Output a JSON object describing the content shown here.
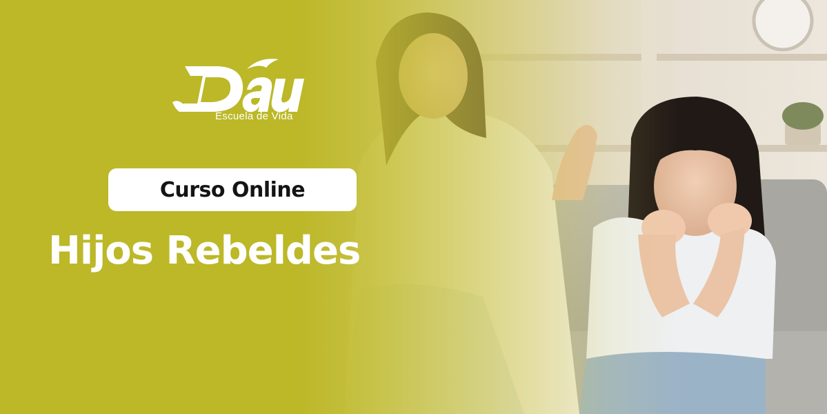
{
  "brand": {
    "logo_text": "Dău",
    "tagline": "Escuela de Vida"
  },
  "badge": {
    "label": "Curso Online"
  },
  "headline": {
    "title": "Hijos Rebeldes"
  },
  "colors": {
    "overlay": "#bcb828",
    "badge_bg": "#ffffff",
    "badge_text": "#141414",
    "title_text": "#ffffff"
  },
  "photo": {
    "subject": "mother-scolding-daughter-on-sofa"
  }
}
